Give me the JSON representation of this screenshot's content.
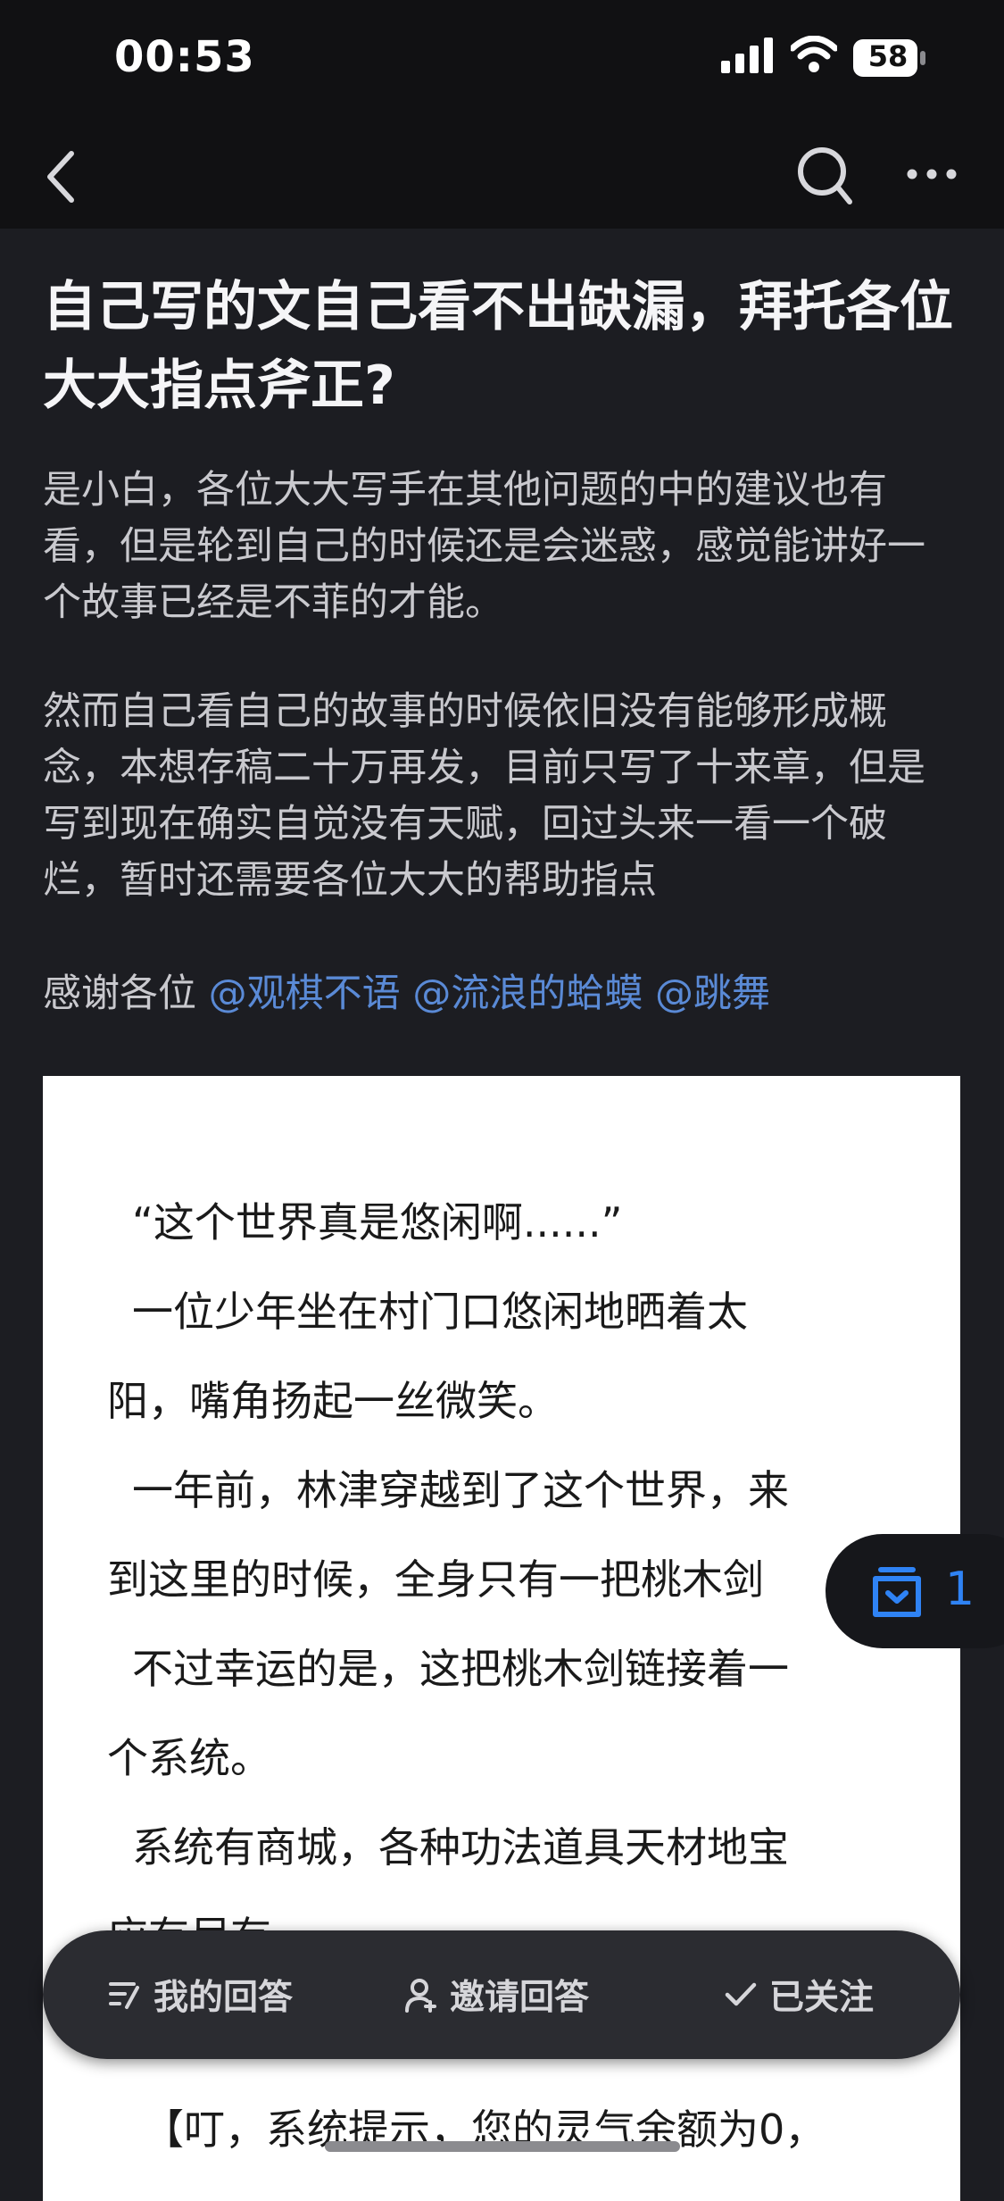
{
  "status_bar": {
    "time": "00:53",
    "battery": "58"
  },
  "question": {
    "title": "自己写的文自己看不出缺漏，拜托各位大大指点斧正?",
    "paragraphs": [
      "是小白，各位大大写手在其他问题的中的建议也有看，但是轮到自己的时候还是会迷惑，感觉能讲好一个故事已经是不菲的才能。",
      "然而自己看自己的故事的时候依旧没有能够形成概念，本想存稿二十万再发，目前只写了十来章，但是写到现在确实自觉没有天赋，回过头来一看一个破烂，暂时还需要各位大大的帮助指点"
    ],
    "thanks_prefix": "感谢各位 ",
    "mentions": [
      "@观棋不语",
      "@流浪的蛤蟆",
      "@跳舞"
    ]
  },
  "image_text": [
    "“这个世界真是悠闲啊......”",
    "一位少年坐在村门口悠闲地晒着太",
    "阳，嘴角扬起一丝微笑。",
    "一年前，林津穿越到了这个世界，来",
    "到这里的时候，全身只有一把桃木剑",
    "不过幸运的是，这把桃木剑链接着一",
    "个系统。",
    "系统有商城，各种功法道具天材地宝",
    "应有尽有。",
    "【叮，系统提示，您的灵气余额为0，"
  ],
  "float_badge": {
    "count": "1"
  },
  "actions": {
    "my_answer": "我的回答",
    "invite": "邀请回答",
    "following": "已关注"
  },
  "colors": {
    "mention": "#5a8ad6",
    "badge_accent": "#2f83f5"
  }
}
